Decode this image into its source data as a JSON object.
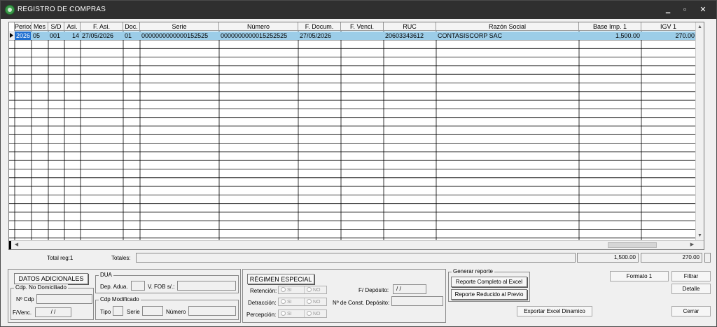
{
  "window": {
    "title": "REGISTRO DE COMPRAS",
    "min": "‗",
    "restore": "▫",
    "close": "✕"
  },
  "grid": {
    "columns": [
      {
        "key": "periodo",
        "label": "Period"
      },
      {
        "key": "mes",
        "label": "Mes"
      },
      {
        "key": "sd",
        "label": "S/D"
      },
      {
        "key": "asi",
        "label": "Asi."
      },
      {
        "key": "fasi",
        "label": "F. Asi."
      },
      {
        "key": "doc",
        "label": "Doc."
      },
      {
        "key": "serie",
        "label": "Serie"
      },
      {
        "key": "numero",
        "label": "Número"
      },
      {
        "key": "fdocum",
        "label": "F. Docum."
      },
      {
        "key": "fvenci",
        "label": "F. Venci."
      },
      {
        "key": "ruc",
        "label": "RUC"
      },
      {
        "key": "razon",
        "label": "Razón Social"
      },
      {
        "key": "base",
        "label": "Base Imp. 1"
      },
      {
        "key": "igv",
        "label": "IGV 1"
      }
    ],
    "rows": [
      [
        "2026",
        "05",
        "001",
        "14",
        "27/05/2026",
        "01",
        "0000000000000152525",
        "0000000000015252525",
        "27/05/2026",
        "",
        "20603343612",
        "CONTASISCORP SAC",
        "1,500.00",
        "270.00"
      ]
    ]
  },
  "totals": {
    "total_reg": "Total reg:1",
    "totales_label": "Totales:",
    "base_total": "1,500.00",
    "igv_total": "270.00"
  },
  "datos": {
    "title": "DATOS ADICIONALES",
    "no_dom_legend": "Cdp. No Domiciliado",
    "n_cdp_label": "Nº Cdp",
    "fvenc_label": "F/Venc.",
    "fvenc_value": " /  /",
    "dua_legend": "DUA",
    "dep_adua_label": "Dep. Adua.",
    "vfob_label": "V. FOB s/.:",
    "cdp_mod_legend": "Cdp Modificado",
    "tipo_label": "Tipo",
    "serie_label": "Serie",
    "numero_label": "Número"
  },
  "regimen": {
    "title": "RÉGIMEN ESPECIAL",
    "retencion": "Retención:",
    "detraccion": "Detracción:",
    "percepcion": "Percepción:",
    "si": "SI",
    "no": "NO",
    "fdeposito_label": "F/ Depósito:",
    "fdeposito_value": " /  /",
    "nconst_label": "Nº de Const. Depósito:"
  },
  "reporte": {
    "legend": "Generar reporte",
    "completo": "Reporte Completo al Excel",
    "reducido": "Reporte Reducido al Previo"
  },
  "actions": {
    "formato": "Formato 1",
    "filtrar": "Filtrar",
    "detalle": "Detalle",
    "exportar": "Exportar Excel Dinamico",
    "cerrar": "Cerrar"
  },
  "colors": {
    "selection": "#9ccde8",
    "titlebar": "#2f2f2f"
  }
}
